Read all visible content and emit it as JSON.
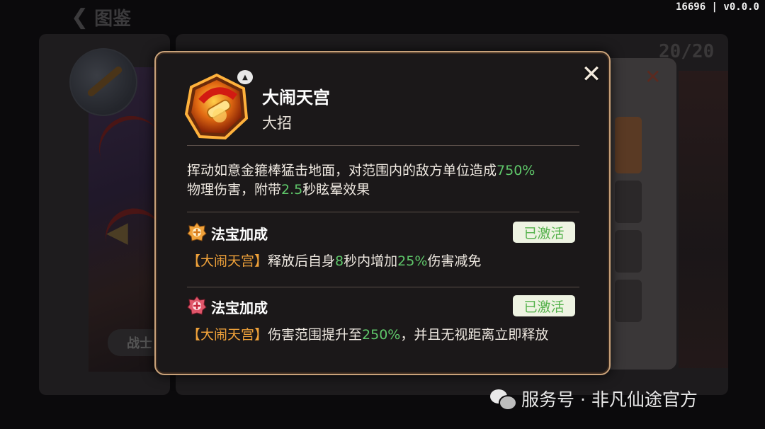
{
  "header": {
    "back_label": "图鉴",
    "version": "16696 | v0.0.0",
    "collection_count": "20/20"
  },
  "background": {
    "character_tag": "战士"
  },
  "skill": {
    "name": "大闹天宫",
    "type": "大招",
    "description": {
      "part1": "挥动如意金箍棒猛击地面，对范围内的敌方单位造成",
      "damage": "750%",
      "part2": "物理伤害，附带",
      "stun_seconds": "2.5",
      "part3": "秒眩晕效果"
    },
    "rank_icon": "triangle-up-icon"
  },
  "bonuses": [
    {
      "title": "法宝加成",
      "status": "已激活",
      "icon": "treasure-gold-icon",
      "ref": "【大闹天宫】",
      "t1": "释放后自身",
      "v1": "8",
      "t2": "秒内增加",
      "v2": "25%",
      "t3": "伤害减免"
    },
    {
      "title": "法宝加成",
      "status": "已激活",
      "icon": "treasure-red-icon",
      "ref": "【大闹天宫】",
      "t1": "伤害范围提升至",
      "v1": "250%",
      "t2": "，并且无视距离立即释放"
    }
  ],
  "colors": {
    "highlight_green": "#5fc76a",
    "highlight_orange": "#f0a23a",
    "frame_gold": "#c9a27a"
  },
  "watermark": {
    "text": "服务号 · 非凡仙途官方",
    "icon": "wechat-icon"
  }
}
